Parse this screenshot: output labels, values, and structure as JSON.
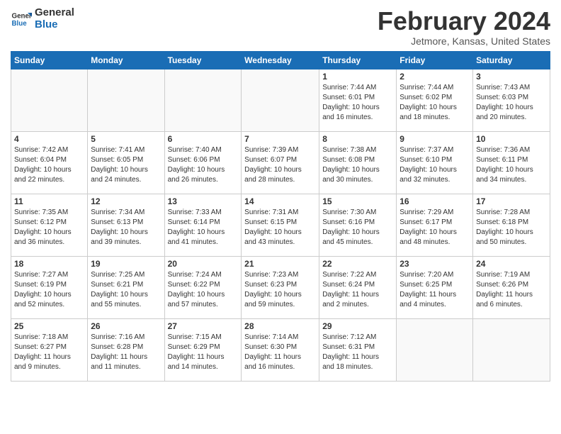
{
  "header": {
    "logo_line1": "General",
    "logo_line2": "Blue",
    "month_title": "February 2024",
    "subtitle": "Jetmore, Kansas, United States"
  },
  "weekdays": [
    "Sunday",
    "Monday",
    "Tuesday",
    "Wednesday",
    "Thursday",
    "Friday",
    "Saturday"
  ],
  "weeks": [
    [
      {
        "day": "",
        "info": ""
      },
      {
        "day": "",
        "info": ""
      },
      {
        "day": "",
        "info": ""
      },
      {
        "day": "",
        "info": ""
      },
      {
        "day": "1",
        "info": "Sunrise: 7:44 AM\nSunset: 6:01 PM\nDaylight: 10 hours\nand 16 minutes."
      },
      {
        "day": "2",
        "info": "Sunrise: 7:44 AM\nSunset: 6:02 PM\nDaylight: 10 hours\nand 18 minutes."
      },
      {
        "day": "3",
        "info": "Sunrise: 7:43 AM\nSunset: 6:03 PM\nDaylight: 10 hours\nand 20 minutes."
      }
    ],
    [
      {
        "day": "4",
        "info": "Sunrise: 7:42 AM\nSunset: 6:04 PM\nDaylight: 10 hours\nand 22 minutes."
      },
      {
        "day": "5",
        "info": "Sunrise: 7:41 AM\nSunset: 6:05 PM\nDaylight: 10 hours\nand 24 minutes."
      },
      {
        "day": "6",
        "info": "Sunrise: 7:40 AM\nSunset: 6:06 PM\nDaylight: 10 hours\nand 26 minutes."
      },
      {
        "day": "7",
        "info": "Sunrise: 7:39 AM\nSunset: 6:07 PM\nDaylight: 10 hours\nand 28 minutes."
      },
      {
        "day": "8",
        "info": "Sunrise: 7:38 AM\nSunset: 6:08 PM\nDaylight: 10 hours\nand 30 minutes."
      },
      {
        "day": "9",
        "info": "Sunrise: 7:37 AM\nSunset: 6:10 PM\nDaylight: 10 hours\nand 32 minutes."
      },
      {
        "day": "10",
        "info": "Sunrise: 7:36 AM\nSunset: 6:11 PM\nDaylight: 10 hours\nand 34 minutes."
      }
    ],
    [
      {
        "day": "11",
        "info": "Sunrise: 7:35 AM\nSunset: 6:12 PM\nDaylight: 10 hours\nand 36 minutes."
      },
      {
        "day": "12",
        "info": "Sunrise: 7:34 AM\nSunset: 6:13 PM\nDaylight: 10 hours\nand 39 minutes."
      },
      {
        "day": "13",
        "info": "Sunrise: 7:33 AM\nSunset: 6:14 PM\nDaylight: 10 hours\nand 41 minutes."
      },
      {
        "day": "14",
        "info": "Sunrise: 7:31 AM\nSunset: 6:15 PM\nDaylight: 10 hours\nand 43 minutes."
      },
      {
        "day": "15",
        "info": "Sunrise: 7:30 AM\nSunset: 6:16 PM\nDaylight: 10 hours\nand 45 minutes."
      },
      {
        "day": "16",
        "info": "Sunrise: 7:29 AM\nSunset: 6:17 PM\nDaylight: 10 hours\nand 48 minutes."
      },
      {
        "day": "17",
        "info": "Sunrise: 7:28 AM\nSunset: 6:18 PM\nDaylight: 10 hours\nand 50 minutes."
      }
    ],
    [
      {
        "day": "18",
        "info": "Sunrise: 7:27 AM\nSunset: 6:19 PM\nDaylight: 10 hours\nand 52 minutes."
      },
      {
        "day": "19",
        "info": "Sunrise: 7:25 AM\nSunset: 6:21 PM\nDaylight: 10 hours\nand 55 minutes."
      },
      {
        "day": "20",
        "info": "Sunrise: 7:24 AM\nSunset: 6:22 PM\nDaylight: 10 hours\nand 57 minutes."
      },
      {
        "day": "21",
        "info": "Sunrise: 7:23 AM\nSunset: 6:23 PM\nDaylight: 10 hours\nand 59 minutes."
      },
      {
        "day": "22",
        "info": "Sunrise: 7:22 AM\nSunset: 6:24 PM\nDaylight: 11 hours\nand 2 minutes."
      },
      {
        "day": "23",
        "info": "Sunrise: 7:20 AM\nSunset: 6:25 PM\nDaylight: 11 hours\nand 4 minutes."
      },
      {
        "day": "24",
        "info": "Sunrise: 7:19 AM\nSunset: 6:26 PM\nDaylight: 11 hours\nand 6 minutes."
      }
    ],
    [
      {
        "day": "25",
        "info": "Sunrise: 7:18 AM\nSunset: 6:27 PM\nDaylight: 11 hours\nand 9 minutes."
      },
      {
        "day": "26",
        "info": "Sunrise: 7:16 AM\nSunset: 6:28 PM\nDaylight: 11 hours\nand 11 minutes."
      },
      {
        "day": "27",
        "info": "Sunrise: 7:15 AM\nSunset: 6:29 PM\nDaylight: 11 hours\nand 14 minutes."
      },
      {
        "day": "28",
        "info": "Sunrise: 7:14 AM\nSunset: 6:30 PM\nDaylight: 11 hours\nand 16 minutes."
      },
      {
        "day": "29",
        "info": "Sunrise: 7:12 AM\nSunset: 6:31 PM\nDaylight: 11 hours\nand 18 minutes."
      },
      {
        "day": "",
        "info": ""
      },
      {
        "day": "",
        "info": ""
      }
    ]
  ]
}
